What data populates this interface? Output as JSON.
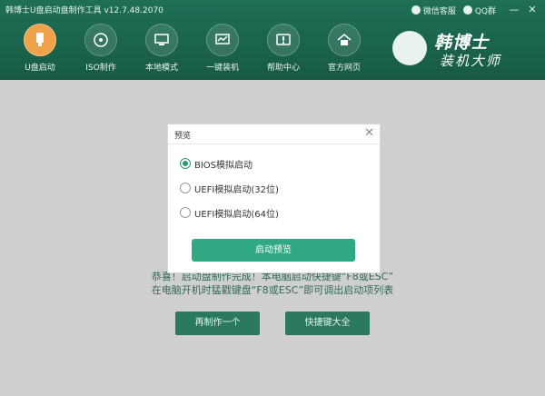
{
  "window": {
    "title": "韩博士U盘启动盘制作工具 v12.7.48.2070",
    "wechat_service": "微信客服",
    "qq_group": "QQ群",
    "minimize": "—",
    "close": "✕"
  },
  "nav": {
    "items": [
      {
        "label": "U盘启动",
        "active": true,
        "icon": "usb-icon"
      },
      {
        "label": "ISO制作",
        "active": false,
        "icon": "disc-icon"
      },
      {
        "label": "本地模式",
        "active": false,
        "icon": "monitor-icon"
      },
      {
        "label": "一键装机",
        "active": false,
        "icon": "install-icon"
      },
      {
        "label": "帮助中心",
        "active": false,
        "icon": "help-icon"
      },
      {
        "label": "官方网页",
        "active": false,
        "icon": "home-icon"
      }
    ]
  },
  "brand": {
    "line1": "韩博士",
    "line2": "装机大师"
  },
  "background": {
    "text1": "恭喜！启动盘制作完成！本电脑启动快捷键“F8或ESC”",
    "text2": "在电脑开机时猛戳键盘“F8或ESC”即可调出启动项列表",
    "remake_button": "再制作一个",
    "shortcut_button": "快捷键大全"
  },
  "modal": {
    "title": "预览",
    "close": "✕",
    "options": [
      {
        "label": "BIOS模拟启动",
        "selected": true
      },
      {
        "label": "UEFI模拟启动(32位)",
        "selected": false
      },
      {
        "label": "UEFI模拟启动(64位)",
        "selected": false
      }
    ],
    "start_button": "启动预览"
  },
  "colors": {
    "header": "#1f6f57",
    "accent": "#2fa883",
    "active_nav": "#f0a24a",
    "overlay_bg": "#cfcfcf"
  }
}
